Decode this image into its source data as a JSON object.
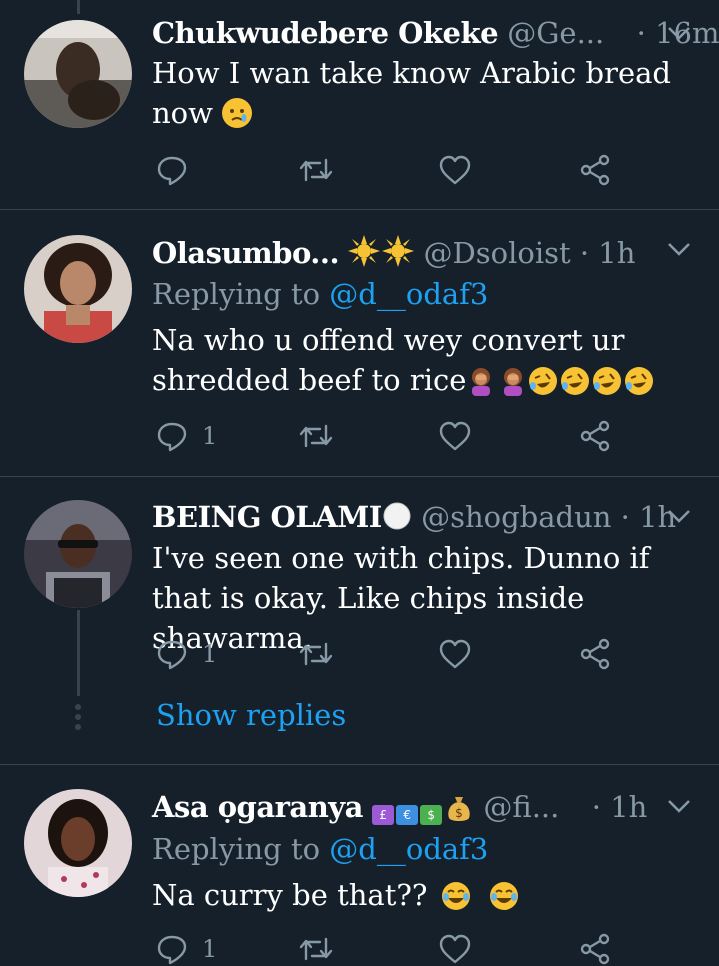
{
  "tweets": [
    {
      "name": "Chukwudebere Okeke",
      "handle": "@Ge...",
      "time": "· 16m",
      "text": "How I wan take know Arabic bread now",
      "reply_count": "",
      "emojis": [
        "crying-face"
      ]
    },
    {
      "name": "Olasumbo...",
      "handle": "@Dsoloist",
      "time": "· 1h",
      "replying_prefix": "Replying to",
      "replying_to": "@d__odaf3",
      "text": "Na who u offend wey convert ur shredded beef to rice",
      "reply_count": "1",
      "emojis": [
        "sun",
        "sun",
        "woman-facepalming",
        "woman-facepalming",
        "rolling-laughing",
        "rolling-laughing",
        "rolling-laughing",
        "rolling-laughing"
      ]
    },
    {
      "name": "BEING OLAMI",
      "handle": "@shogbadun",
      "time": "· 1h",
      "text": "I've seen one with chips. Dunno if that is okay. Like chips inside shawarma.",
      "reply_count": "1",
      "show_replies": "Show replies",
      "emojis": [
        "white-circle"
      ]
    },
    {
      "name": "Asa ọgaranya",
      "handle": "@fi...",
      "time": "· 1h",
      "replying_prefix": "Replying to",
      "replying_to": "@d__odaf3",
      "text": "Na curry be that??",
      "reply_count": "1",
      "flags": [
        "£",
        "€",
        "$"
      ],
      "emojis": [
        "money-bag",
        "joy",
        "joy"
      ]
    }
  ],
  "colors": {
    "background": "#15202b",
    "divider": "#38444d",
    "muted": "#8899a6",
    "accent": "#1da1f2"
  },
  "icons": [
    "reply-icon",
    "retweet-icon",
    "like-icon",
    "share-icon",
    "chevron-down-icon"
  ]
}
